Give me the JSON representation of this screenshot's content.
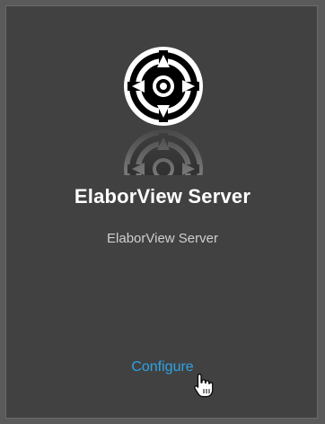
{
  "card": {
    "logo_icon": "crosshair-target-icon",
    "title": "ElaborView Server",
    "subtitle": "ElaborView Server",
    "action_label": "Configure",
    "cursor_icon": "hand-pointer-icon"
  },
  "colors": {
    "background": "#555555",
    "card_background": "#414141",
    "title": "#ffffff",
    "subtitle": "#cfcfcf",
    "link": "#2ea3e6"
  }
}
